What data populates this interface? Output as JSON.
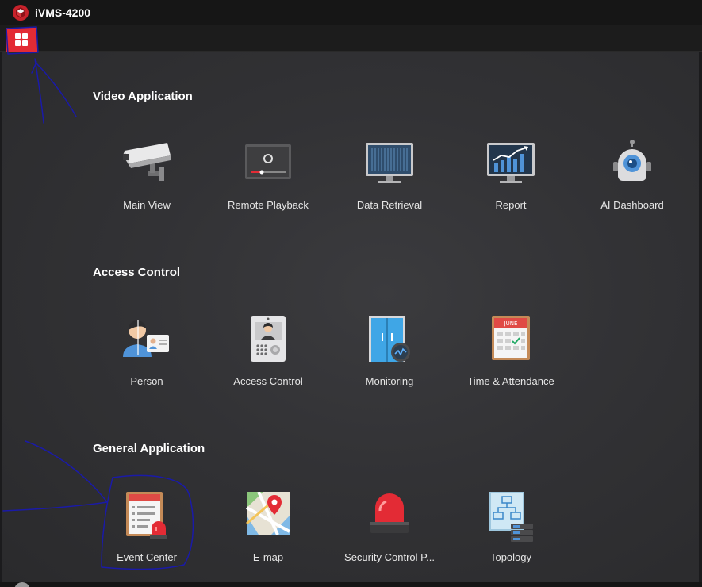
{
  "app": {
    "title": "iVMS-4200",
    "logo_icon": "hikvision-logo-icon"
  },
  "toolbar": {
    "home_icon": "grid-icon",
    "home_color": "#e32b35"
  },
  "sections": [
    {
      "title": "Video Application",
      "items": [
        {
          "label": "Main View",
          "icon": "camera-icon"
        },
        {
          "label": "Remote Playback",
          "icon": "playback-icon"
        },
        {
          "label": "Data Retrieval",
          "icon": "monitor-icon"
        },
        {
          "label": "Report",
          "icon": "chart-icon"
        },
        {
          "label": "AI Dashboard",
          "icon": "robot-icon"
        }
      ]
    },
    {
      "title": "Access Control",
      "items": [
        {
          "label": "Person",
          "icon": "person-icon"
        },
        {
          "label": "Access Control",
          "icon": "intercom-icon"
        },
        {
          "label": "Monitoring",
          "icon": "door-monitor-icon"
        },
        {
          "label": "Time & Attendance",
          "icon": "calendar-icon",
          "calendar_month": "JUNE"
        }
      ]
    },
    {
      "title": "General Application",
      "items": [
        {
          "label": "Event Center",
          "icon": "alarm-list-icon"
        },
        {
          "label": "E-map",
          "icon": "map-icon"
        },
        {
          "label": "Security Control P...",
          "icon": "siren-icon"
        },
        {
          "label": "Topology",
          "icon": "topology-icon"
        }
      ]
    }
  ],
  "colors": {
    "accent": "#e32b35",
    "annotation": "#1a1aa8"
  }
}
